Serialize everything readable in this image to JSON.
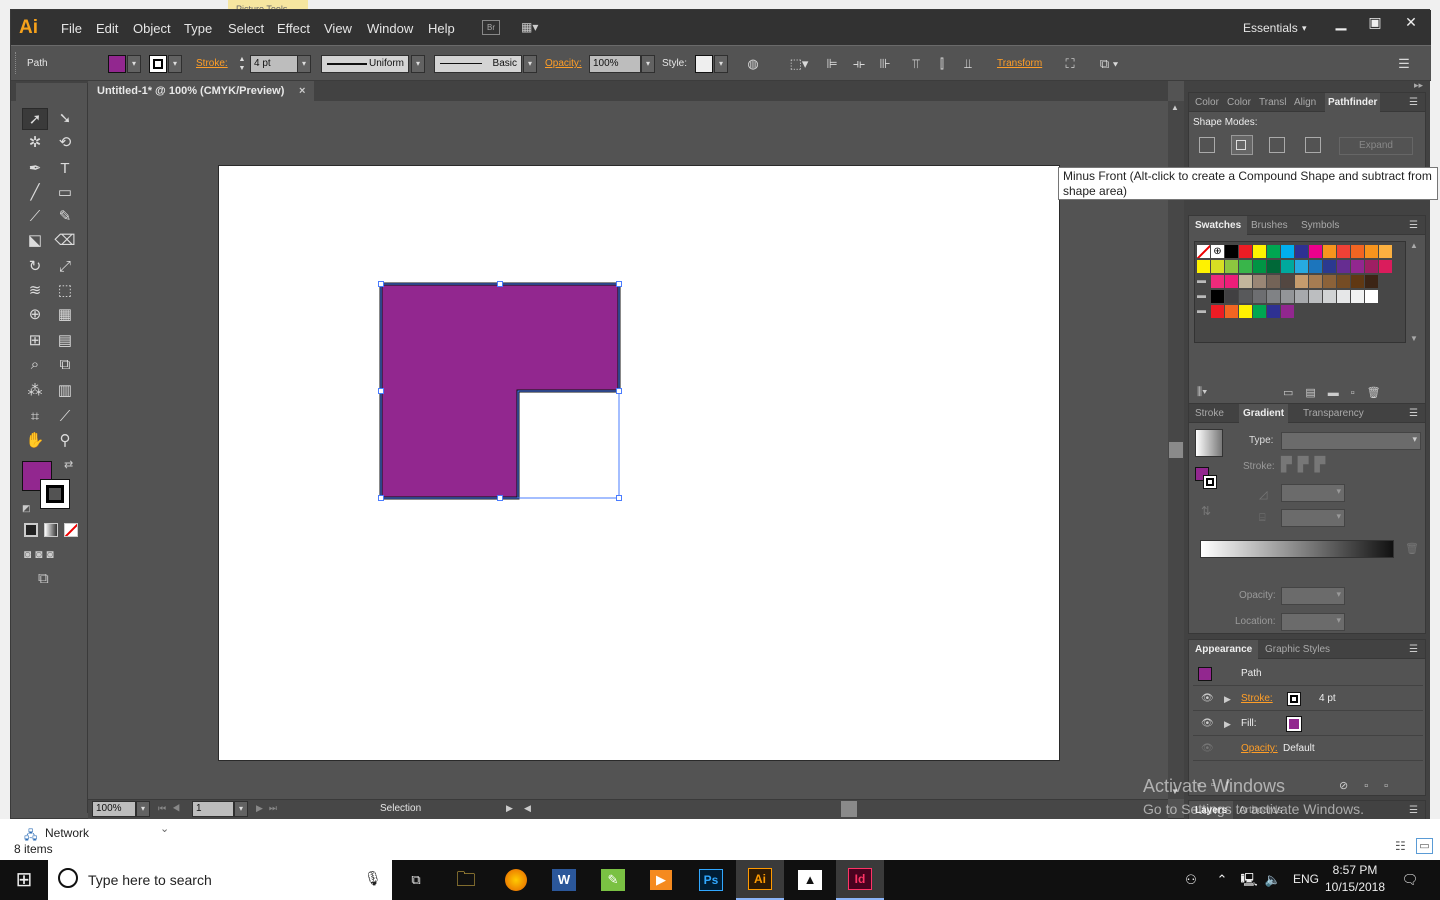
{
  "background": {
    "picture_tools": "Picture Tools"
  },
  "app": {
    "logo": "Ai",
    "workspace": "Essentials"
  },
  "menu": [
    "File",
    "Edit",
    "Object",
    "Type",
    "Select",
    "Effect",
    "View",
    "Window",
    "Help"
  ],
  "control": {
    "selection_type": "Path",
    "fill_color": "#92278f",
    "stroke_label": "Stroke:",
    "stroke_weight": "4 pt",
    "profile": "Uniform",
    "brush": "Basic",
    "opacity_label": "Opacity:",
    "opacity": "100%",
    "style_label": "Style:",
    "transform_label": "Transform"
  },
  "document": {
    "tab_title": "Untitled-1* @ 100% (CMYK/Preview)"
  },
  "shape": {
    "fill": "#92278f",
    "stroke": "#111111",
    "stroke_weight_pt": 4
  },
  "status": {
    "zoom": "100%",
    "artboard": "1",
    "tool": "Selection"
  },
  "tooltip": {
    "text": "Minus Front (Alt-click to create a Compound Shape and subtract from shape area)"
  },
  "pathfinder": {
    "tabs": [
      "Color",
      "Color",
      "Transl",
      "Align",
      "Pathfinder"
    ],
    "shape_modes_label": "Shape Modes:",
    "expand_label": "Expand"
  },
  "swatches": {
    "tabs": [
      "Swatches",
      "Brushes",
      "Symbols"
    ],
    "rows": [
      [
        "#ffffff",
        "#ffffff",
        "#000000",
        "#ed1c24",
        "#fff200",
        "#00a651",
        "#00aeef",
        "#2e3192",
        "#ec008c",
        "#f7941d",
        "#ef4136",
        "#f26522",
        "#f7941d",
        "#fbb040"
      ],
      [
        "#fff200",
        "#d7df23",
        "#8dc63f",
        "#39b54a",
        "#009444",
        "#006838",
        "#00a99d",
        "#27aae1",
        "#1c75bc",
        "#2b3990",
        "#662d91",
        "#92278f",
        "#9e1f63",
        "#da1c5c"
      ],
      [
        "#ee2a7b",
        "#ed1e79",
        "#c2b59b",
        "#998675",
        "#736357",
        "#534741",
        "#c69c6d",
        "#a67c52",
        "#8c6239",
        "#754c24",
        "#603813",
        "#3c2415"
      ],
      [
        "#000000",
        "#414042",
        "#58595b",
        "#6d6e71",
        "#808285",
        "#939598",
        "#a7a9ac",
        "#bcbec0",
        "#d1d3d4",
        "#e6e7e8",
        "#f1f2f2",
        "#ffffff"
      ],
      [
        "#ed1c24",
        "#f26522",
        "#fff200",
        "#00a651",
        "#2e3192",
        "#92278f"
      ]
    ]
  },
  "gradient": {
    "tabs": [
      "Stroke",
      "Gradient",
      "Transparency"
    ],
    "type_label": "Type:",
    "stroke_label": "Stroke:",
    "opacity_label": "Opacity:",
    "location_label": "Location:"
  },
  "appearance": {
    "tabs": [
      "Appearance",
      "Graphic Styles"
    ],
    "item": "Path",
    "stroke_label": "Stroke:",
    "stroke_value": "4 pt",
    "fill_label": "Fill:",
    "opacity_label": "Opacity:",
    "opacity_value": "Default"
  },
  "layers": {
    "tabs": [
      "Layers",
      "Artboards"
    ]
  },
  "explorer": {
    "network": "Network",
    "items": "8 items"
  },
  "watermark": {
    "line1": "Activate Windows",
    "line2": "Go to Settings to activate Windows."
  },
  "taskbar": {
    "search_placeholder": "Type here to search",
    "language": "ENG",
    "time": "8:57 PM",
    "date": "10/15/2018",
    "apps": [
      "Ps",
      "Ai",
      "Id"
    ]
  }
}
